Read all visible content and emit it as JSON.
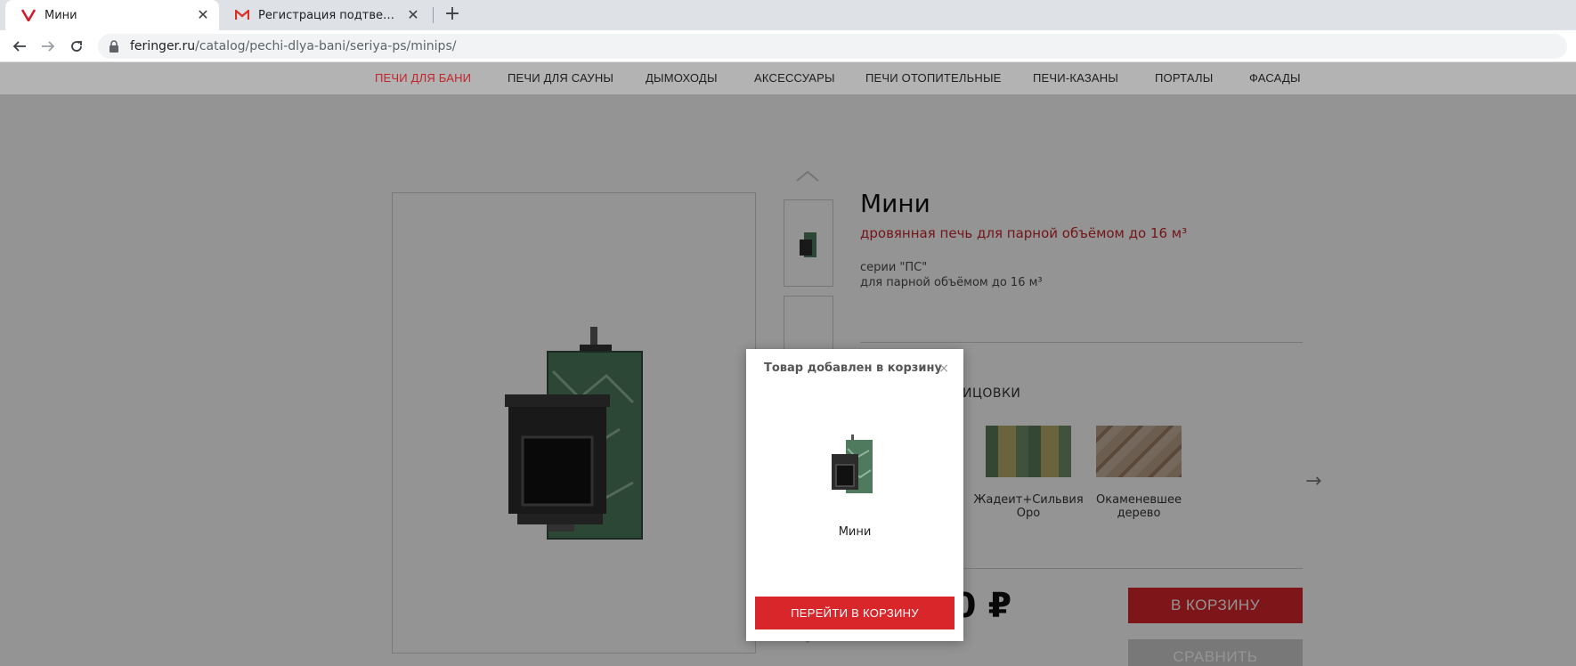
{
  "browser": {
    "tabs": [
      {
        "title": "Мини",
        "favicon": "vivaldi-v-icon",
        "active": true
      },
      {
        "title": "Регистрация подтверждена - an",
        "favicon": "gmail-m-icon",
        "active": false
      }
    ],
    "address": {
      "host": "feringer.ru",
      "path": "/catalog/pechi-dlya-bani/seriya-ps/minips/"
    }
  },
  "site_nav": {
    "items": [
      {
        "label": "ПЕЧИ ДЛЯ БАНИ",
        "active": true
      },
      {
        "label": "ПЕЧИ ДЛЯ САУНЫ"
      },
      {
        "label": "ДЫМОХОДЫ"
      },
      {
        "label": "АКСЕССУАРЫ"
      },
      {
        "label": "ПЕЧИ ОТОПИТЕЛЬНЫЕ"
      },
      {
        "label": "ПЕЧИ-КАЗАНЫ"
      },
      {
        "label": "ПОРТАЛЫ"
      },
      {
        "label": "ФАСАДЫ"
      }
    ],
    "active_color": "#c0262b"
  },
  "product": {
    "title": "Мини",
    "subtitle": "дровянная печь для парной объёмом до 16 м³",
    "series_line1": "серии \"ПС\"",
    "series_line2": "для парной объёмом до 16 м³",
    "finish_label": "ЛИЦОВКИ",
    "finishes": [
      {
        "name": "Жадеит+Сильвия Оро"
      },
      {
        "name": "Окаменевшее дерево"
      }
    ],
    "price_fragment": "0 ₽",
    "cart_button": "В КОРЗИНУ",
    "compare_button": "СРАВНИТЬ",
    "next_arrow": "→",
    "accent_color": "#d9262b"
  },
  "modal": {
    "title": "Товар добавлен в корзину",
    "close": "×",
    "item_name": "Мини",
    "button": "ПЕРЕЙТИ В КОРЗИНУ"
  }
}
